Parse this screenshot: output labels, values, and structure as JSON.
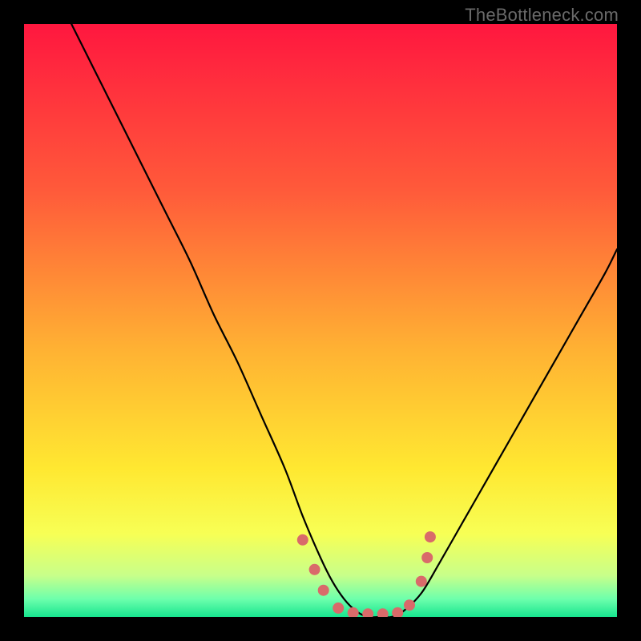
{
  "attribution": "TheBottleneck.com",
  "chart_data": {
    "type": "line",
    "title": "",
    "xlabel": "",
    "ylabel": "",
    "xlim": [
      0,
      100
    ],
    "ylim": [
      0,
      100
    ],
    "gradient_stops": [
      {
        "offset": 0,
        "color": "#ff173f"
      },
      {
        "offset": 28,
        "color": "#ff5a3a"
      },
      {
        "offset": 55,
        "color": "#ffb233"
      },
      {
        "offset": 75,
        "color": "#ffe831"
      },
      {
        "offset": 86,
        "color": "#f7ff55"
      },
      {
        "offset": 93,
        "color": "#c8ff8a"
      },
      {
        "offset": 97,
        "color": "#6dffac"
      },
      {
        "offset": 100,
        "color": "#17e58f"
      }
    ],
    "series": [
      {
        "name": "bottleneck-curve",
        "stroke": "#000000",
        "x": [
          8,
          12,
          16,
          20,
          24,
          28,
          32,
          36,
          40,
          44,
          47,
          50,
          52,
          54,
          56,
          58,
          60,
          62,
          64,
          67,
          70,
          74,
          78,
          82,
          86,
          90,
          94,
          98,
          100
        ],
        "y": [
          100,
          92,
          84,
          76,
          68,
          60,
          51,
          43,
          34,
          25,
          17,
          10,
          6,
          3,
          1,
          0,
          0,
          0,
          1,
          4,
          9,
          16,
          23,
          30,
          37,
          44,
          51,
          58,
          62
        ]
      }
    ],
    "markers": {
      "color": "#d96a6a",
      "radius": 7,
      "points": [
        {
          "x": 47.0,
          "y": 13.0
        },
        {
          "x": 49.0,
          "y": 8.0
        },
        {
          "x": 50.5,
          "y": 4.5
        },
        {
          "x": 53.0,
          "y": 1.5
        },
        {
          "x": 55.5,
          "y": 0.7
        },
        {
          "x": 58.0,
          "y": 0.5
        },
        {
          "x": 60.5,
          "y": 0.5
        },
        {
          "x": 63.0,
          "y": 0.7
        },
        {
          "x": 65.0,
          "y": 2.0
        },
        {
          "x": 67.0,
          "y": 6.0
        },
        {
          "x": 68.0,
          "y": 10.0
        },
        {
          "x": 68.5,
          "y": 13.5
        }
      ]
    }
  }
}
